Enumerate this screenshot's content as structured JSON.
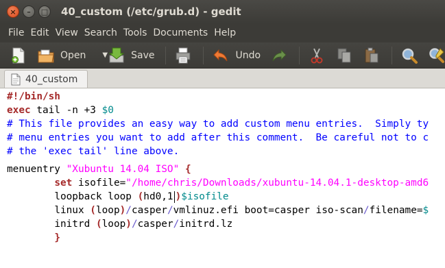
{
  "window": {
    "title": "40_custom (/etc/grub.d) - gedit",
    "controls": [
      "close",
      "minimize",
      "maximize"
    ]
  },
  "menubar": {
    "items": [
      "File",
      "Edit",
      "View",
      "Search",
      "Tools",
      "Documents",
      "Help"
    ]
  },
  "toolbar": {
    "open_label": "Open",
    "save_label": "Save",
    "undo_label": "Undo",
    "icons": [
      "new-document-icon",
      "open-folder-icon",
      "save-icon",
      "print-icon",
      "undo-icon",
      "redo-icon",
      "cut-icon",
      "copy-icon",
      "paste-icon",
      "find-icon",
      "find-replace-icon"
    ]
  },
  "tab": {
    "label": "40_custom"
  },
  "editor": {
    "lines": [
      "#!/bin/sh",
      "exec tail -n +3 $0",
      "# This file provides an easy way to add custom menu entries.  Simply ty",
      "# menu entries you want to add after this comment.  Be careful not to c",
      "# the 'exec tail' line above.",
      "",
      "menuentry \"Xubuntu 14.04 ISO\" {",
      "        set isofile=\"/home/chris/Downloads/xubuntu-14.04.1-desktop-amd6",
      "        loopback loop (hd0,1)$isofile",
      "        linux (loop)/casper/vmlinuz.efi boot=casper iso-scan/filename=$",
      "        initrd (loop)/casper/initrd.lz",
      "        }"
    ],
    "tokens": {
      "shebang": "#!/bin/sh",
      "exec_kw": "exec",
      "exec_rest": " tail -n +3 ",
      "exec_var": "$0",
      "comment1": "# This file provides an easy way to add custom menu entries.  Simply ty",
      "comment2": "# menu entries you want to add after this comment.  Be careful not to c",
      "comment3": "# the 'exec tail' line above.",
      "menuentry": "menuentry ",
      "menuentry_str": "\"Xubuntu 14.04 ISO\"",
      "open_brace": "{",
      "indent": "        ",
      "set_kw": "set",
      "set_rest": " isofile=",
      "set_str": "\"/home/chris/Downloads/xubuntu-14.04.1-desktop-amd6",
      "loopback_a": "loopback loop ",
      "loopback_paren_open": "(",
      "loopback_hd": "hd0,1",
      "loopback_paren_close": ")",
      "loopback_var": "$isofile",
      "linux_a": "linux ",
      "linux_p1": "(",
      "linux_loop": "loop",
      "linux_p2": ")",
      "linux_s1": "/",
      "linux_casper": "casper",
      "linux_s2": "/",
      "linux_rest": "vmlinuz.efi boot=casper iso-scan",
      "linux_s3": "/",
      "linux_rest2": "filename=",
      "linux_var": "$",
      "initrd_a": "initrd ",
      "initrd_p1": "(",
      "initrd_loop": "loop",
      "initrd_p2": ")",
      "initrd_s1": "/",
      "initrd_casper": "casper",
      "initrd_s2": "/",
      "initrd_rest": "initrd.lz",
      "close_brace": "}"
    }
  },
  "colors": {
    "keyword": "#a52a2a",
    "comment": "#0000ff",
    "variable": "#008a8c",
    "string": "#ff00ff",
    "symbol": "#6a5acd",
    "chrome": "#3c3b37",
    "close_button": "#d8471a"
  }
}
